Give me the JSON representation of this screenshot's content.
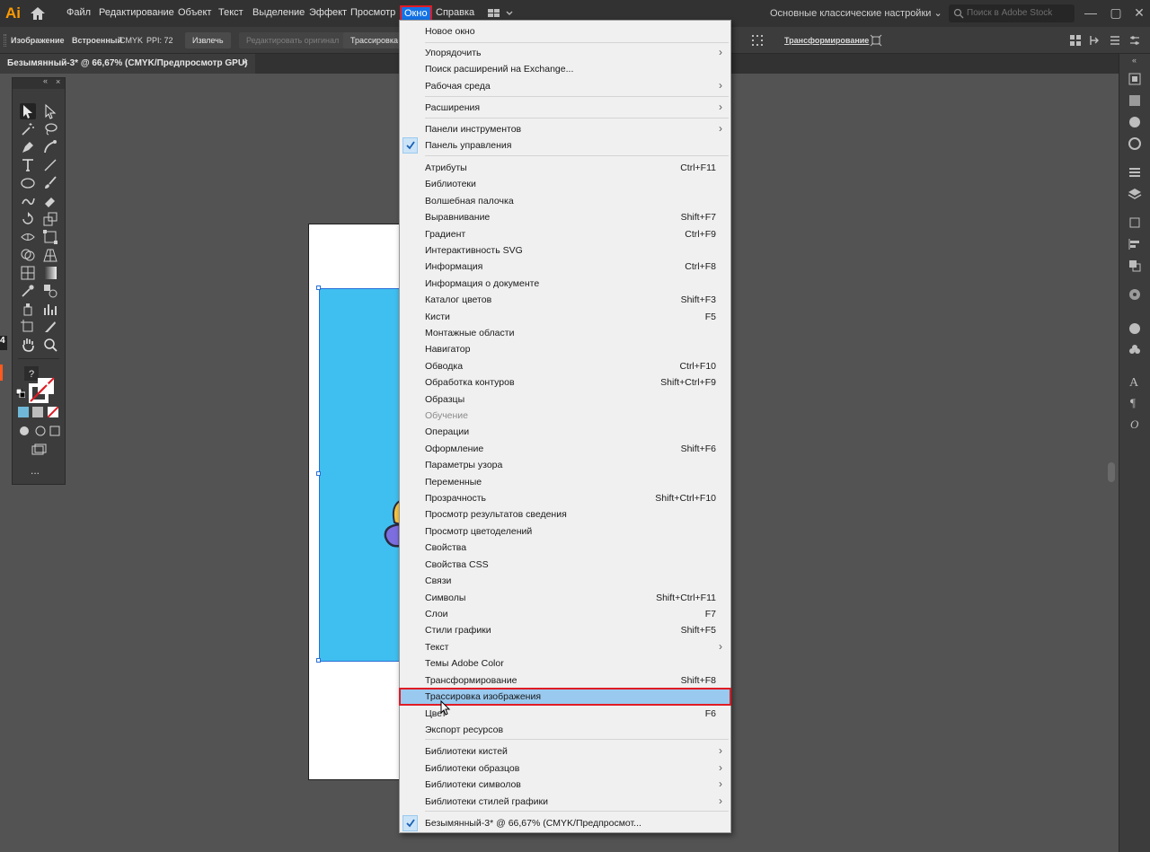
{
  "app": {
    "logo": "Ai",
    "menus": [
      "Файл",
      "Редактирование",
      "Объект",
      "Текст",
      "Выделение",
      "Эффект",
      "Просмотр",
      "Окно",
      "Справка"
    ],
    "workspace": "Основные классические настройки",
    "stock_search_placeholder": "Поиск в Adobe Stock",
    "accent_color": "#1473e6",
    "highlight_outline_color": "#e01b24"
  },
  "control_bar": {
    "object_type": "Изображение",
    "embedded": "Встроенный",
    "color_mode": "CMYK",
    "ppi": "PPI: 72",
    "extract_button": "Извлечь",
    "edit_original_button": "Редактировать оригинал",
    "trace_button": "Трассировка и",
    "transform_link": "Трансформирование"
  },
  "document_tab": {
    "title": "Безымянный-3* @ 66,67% (CMYK/Предпросмотр GPU)",
    "close": "×"
  },
  "left_edge": {
    "badge": "4"
  },
  "tools_panel": {
    "more": "..."
  },
  "window_menu": {
    "items": [
      {
        "label": "Новое окно",
        "shortcut": "",
        "submenu": false
      },
      {
        "label": "Упорядочить",
        "shortcut": "",
        "submenu": true
      },
      {
        "label": "Поиск расширений на Exchange...",
        "shortcut": "",
        "submenu": false
      },
      {
        "label": "Рабочая среда",
        "shortcut": "",
        "submenu": true
      },
      {
        "label": "Расширения",
        "shortcut": "",
        "submenu": true
      },
      {
        "label": "Панели инструментов",
        "shortcut": "",
        "submenu": true
      },
      {
        "label": "Панель управления",
        "shortcut": "",
        "submenu": false,
        "checked": true
      },
      {
        "label": "Атрибуты",
        "shortcut": "Ctrl+F11"
      },
      {
        "label": "Библиотеки",
        "shortcut": ""
      },
      {
        "label": "Волшебная палочка",
        "shortcut": ""
      },
      {
        "label": "Выравнивание",
        "shortcut": "Shift+F7"
      },
      {
        "label": "Градиент",
        "shortcut": "Ctrl+F9"
      },
      {
        "label": "Интерактивность SVG",
        "shortcut": ""
      },
      {
        "label": "Информация",
        "shortcut": "Ctrl+F8"
      },
      {
        "label": "Информация о документе",
        "shortcut": ""
      },
      {
        "label": "Каталог цветов",
        "shortcut": "Shift+F3"
      },
      {
        "label": "Кисти",
        "shortcut": "F5"
      },
      {
        "label": "Монтажные области",
        "shortcut": ""
      },
      {
        "label": "Навигатор",
        "shortcut": ""
      },
      {
        "label": "Обводка",
        "shortcut": "Ctrl+F10"
      },
      {
        "label": "Обработка контуров",
        "shortcut": "Shift+Ctrl+F9"
      },
      {
        "label": "Образцы",
        "shortcut": ""
      },
      {
        "label": "Обучение",
        "shortcut": "",
        "disabled": true
      },
      {
        "label": "Операции",
        "shortcut": ""
      },
      {
        "label": "Оформление",
        "shortcut": "Shift+F6"
      },
      {
        "label": "Параметры узора",
        "shortcut": ""
      },
      {
        "label": "Переменные",
        "shortcut": ""
      },
      {
        "label": "Прозрачность",
        "shortcut": "Shift+Ctrl+F10"
      },
      {
        "label": "Просмотр результатов сведения",
        "shortcut": ""
      },
      {
        "label": "Просмотр цветоделений",
        "shortcut": ""
      },
      {
        "label": "Свойства",
        "shortcut": ""
      },
      {
        "label": "Свойства CSS",
        "shortcut": ""
      },
      {
        "label": "Связи",
        "shortcut": ""
      },
      {
        "label": "Символы",
        "shortcut": "Shift+Ctrl+F11"
      },
      {
        "label": "Слои",
        "shortcut": "F7"
      },
      {
        "label": "Стили графики",
        "shortcut": "Shift+F5"
      },
      {
        "label": "Текст",
        "shortcut": "",
        "submenu": true
      },
      {
        "label": "Темы Adobe Color",
        "shortcut": ""
      },
      {
        "label": "Трансформирование",
        "shortcut": "Shift+F8"
      },
      {
        "label": "Трассировка изображения",
        "shortcut": "",
        "highlighted": true
      },
      {
        "label": "Цвет",
        "shortcut": "F6"
      },
      {
        "label": "Экспорт ресурсов",
        "shortcut": ""
      },
      {
        "label": "Библиотеки кистей",
        "shortcut": "",
        "submenu": true
      },
      {
        "label": "Библиотеки образцов",
        "shortcut": "",
        "submenu": true
      },
      {
        "label": "Библиотеки символов",
        "shortcut": "",
        "submenu": true
      },
      {
        "label": "Библиотеки стилей графики",
        "shortcut": "",
        "submenu": true
      },
      {
        "label": "Безымянный-3* @ 66,67% (CMYK/Предпросмот...",
        "shortcut": "",
        "checked": true
      }
    ]
  }
}
